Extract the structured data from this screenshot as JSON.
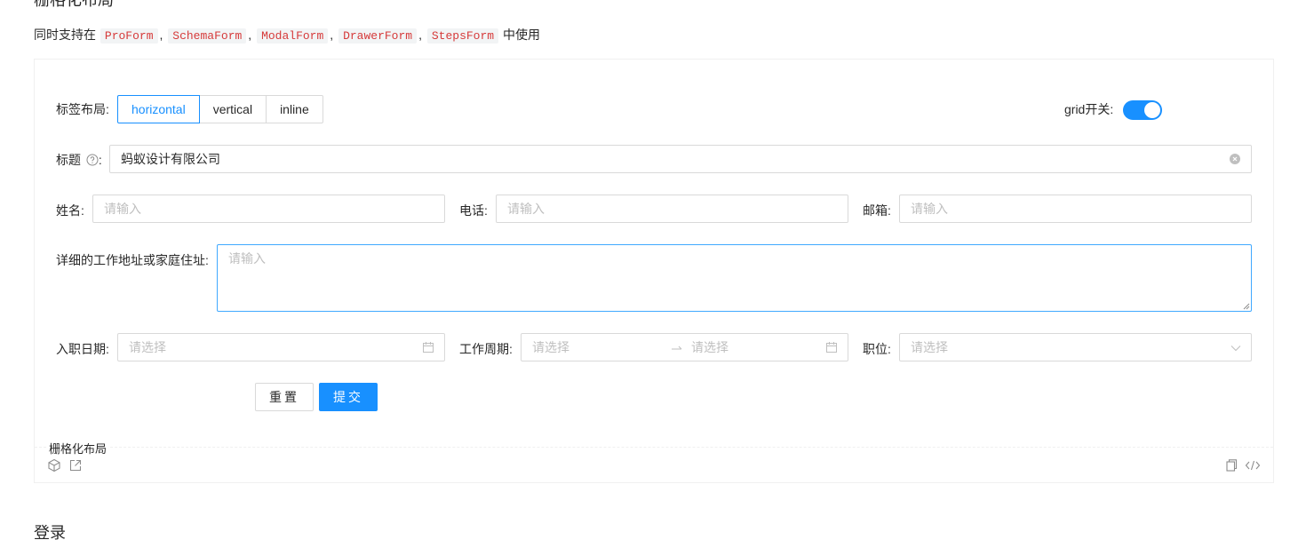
{
  "section_title": "栅格化布局",
  "intro": {
    "prefix": "同时支持在",
    "components": [
      "ProForm",
      "SchemaForm",
      "ModalForm",
      "DrawerForm",
      "StepsForm"
    ],
    "separator": ",",
    "suffix": "中使用"
  },
  "form": {
    "layout_label": "标签布局:",
    "layout_options": [
      "horizontal",
      "vertical",
      "inline"
    ],
    "layout_selected": "horizontal",
    "grid_label": "grid开关:",
    "grid_on": true,
    "title_label": "标题",
    "title_value": "蚂蚁设计有限公司",
    "name_label": "姓名:",
    "name_placeholder": "请输入",
    "phone_label": "电话:",
    "phone_placeholder": "请输入",
    "email_label": "邮箱:",
    "email_placeholder": "请输入",
    "address_label": "详细的工作地址或家庭住址:",
    "address_placeholder": "请输入",
    "entry_date_label": "入职日期:",
    "entry_date_placeholder": "请选择",
    "work_period_label": "工作周期:",
    "work_period_start_placeholder": "请选择",
    "work_period_end_placeholder": "请选择",
    "position_label": "职位:",
    "position_placeholder": "请选择",
    "reset_label": "重置",
    "submit_label": "提交"
  },
  "demo_meta_title": "栅格化布局",
  "next_section_title": "登录",
  "colors": {
    "primary": "#1890ff",
    "code_text": "#d63a3a",
    "placeholder": "#bfbfbf",
    "border": "#d9d9d9"
  }
}
